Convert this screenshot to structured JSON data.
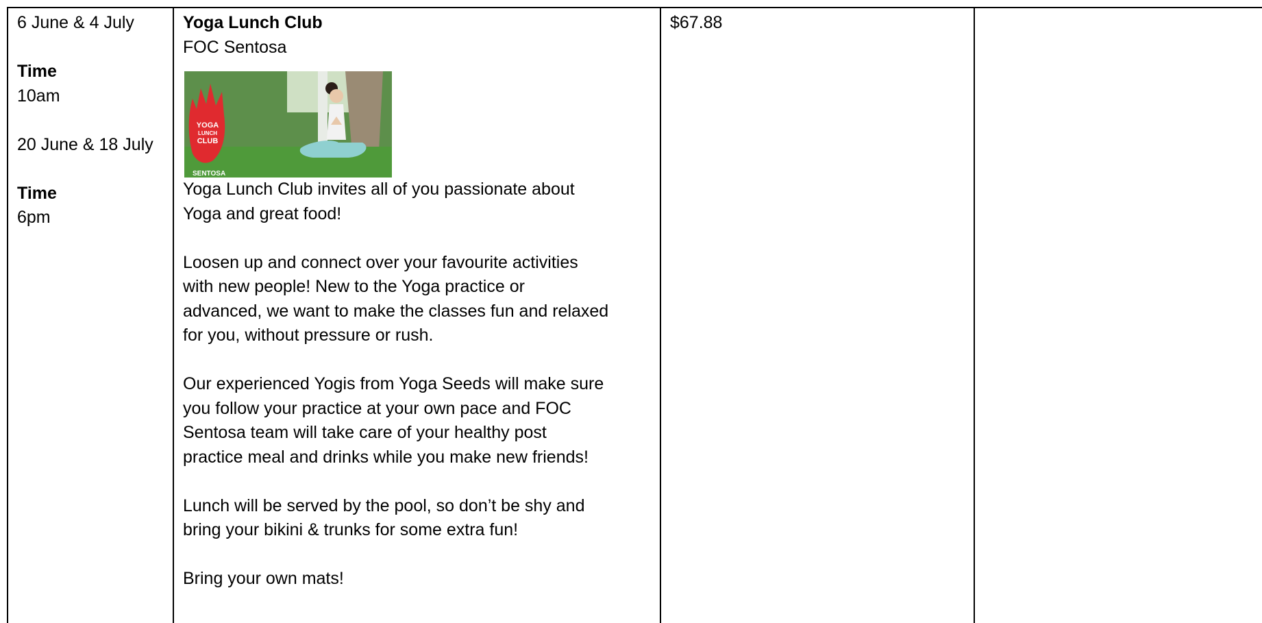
{
  "schedule": {
    "first_dates": "6 June & 4 July",
    "first_time_label": "Time",
    "first_time": "10am",
    "second_dates": "20 June & 18 July",
    "second_time_label": "Time",
    "second_time": "6pm"
  },
  "event": {
    "title": "Yoga Lunch Club",
    "venue": "FOC Sentosa",
    "image_icon": "yoga-lunch-club-photo",
    "image_text": {
      "logo_line1": "YOGA",
      "logo_line2": "LUNCH",
      "logo_line3": "CLUB",
      "brand": "SENTOSA"
    },
    "paragraphs": [
      [
        "Yoga Lunch Club invites all of you passionate about",
        "Yoga and great food!"
      ],
      [
        "Loosen up and connect over your favourite activities",
        "with new people! New to the Yoga practice or",
        "advanced, we want to make the classes fun and relaxed",
        "for you, without pressure or rush."
      ],
      [
        "Our experienced Yogis from Yoga Seeds will make sure",
        "you follow your practice at your own pace and FOC",
        "Sentosa team will take care of your healthy post",
        "practice meal and drinks while you make new friends!"
      ],
      [
        "Lunch will be served by the pool, so don’t be shy and",
        "bring your bikini & trunks for some extra fun!"
      ],
      [
        "Bring your own mats!"
      ]
    ]
  },
  "price": "$67.88",
  "colors": {
    "border": "#000000",
    "logo_red": "#e02a2f",
    "grass": "#4f9a3a"
  }
}
